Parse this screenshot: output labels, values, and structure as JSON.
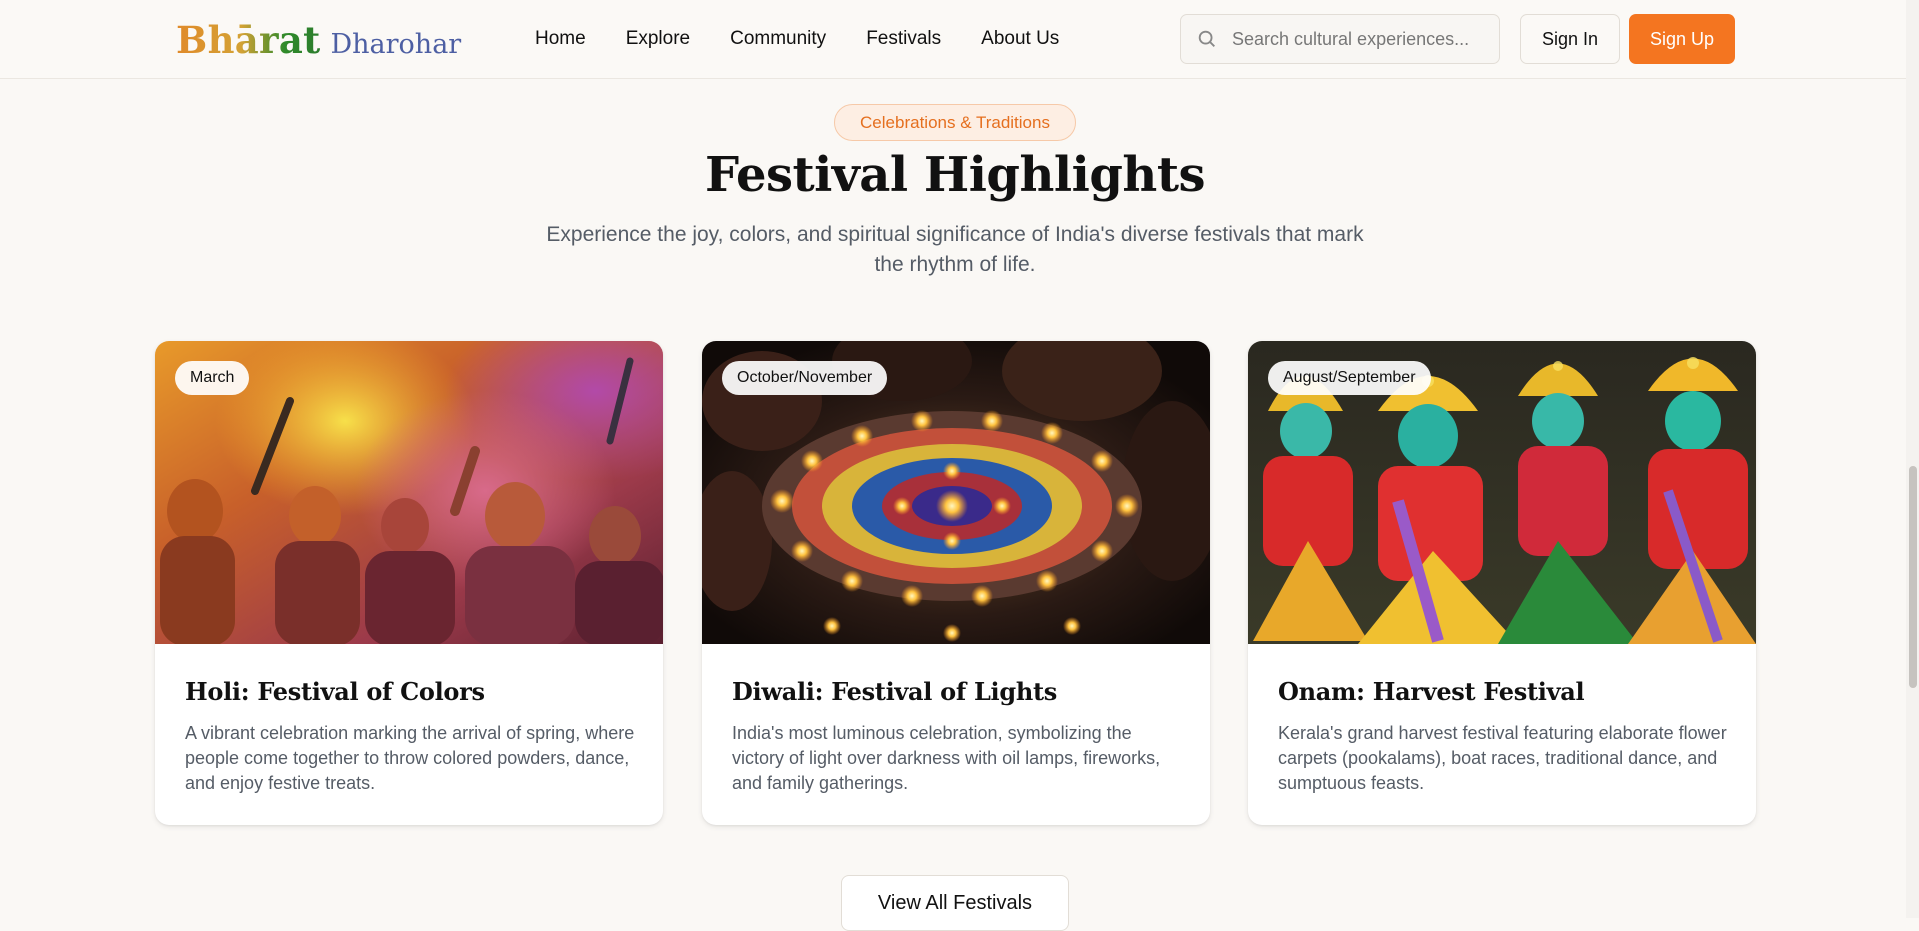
{
  "header": {
    "brand_main": "Bhārat",
    "brand_sub": "Dharohar",
    "nav": [
      "Home",
      "Explore",
      "Community",
      "Festivals",
      "About Us"
    ],
    "search_placeholder": "Search cultural experiences...",
    "signin_label": "Sign In",
    "signup_label": "Sign Up"
  },
  "section": {
    "eyebrow": "Celebrations & Traditions",
    "title": "Festival Highlights",
    "subtitle": "Experience the joy, colors, and spiritual significance of India's diverse festivals that mark the rhythm of life."
  },
  "festivals": [
    {
      "month": "March",
      "title": "Holi: Festival of Colors",
      "description": "A vibrant celebration marking the arrival of spring, where people come together to throw colored powders, dance, and enjoy festive treats."
    },
    {
      "month": "October/November",
      "title": "Diwali: Festival of Lights",
      "description": "India's most luminous celebration, symbolizing the victory of light over darkness with oil lamps, fireworks, and family gatherings."
    },
    {
      "month": "August/September",
      "title": "Onam: Harvest Festival",
      "description": "Kerala's grand harvest festival featuring elaborate flower carpets (pookalams), boat races, traditional dance, and sumptuous feasts."
    }
  ],
  "view_all_label": "View All Festivals",
  "colors": {
    "accent": "#f47520",
    "eyebrow_bg": "#fdeee3",
    "brand_sub": "#4d5fa3"
  }
}
